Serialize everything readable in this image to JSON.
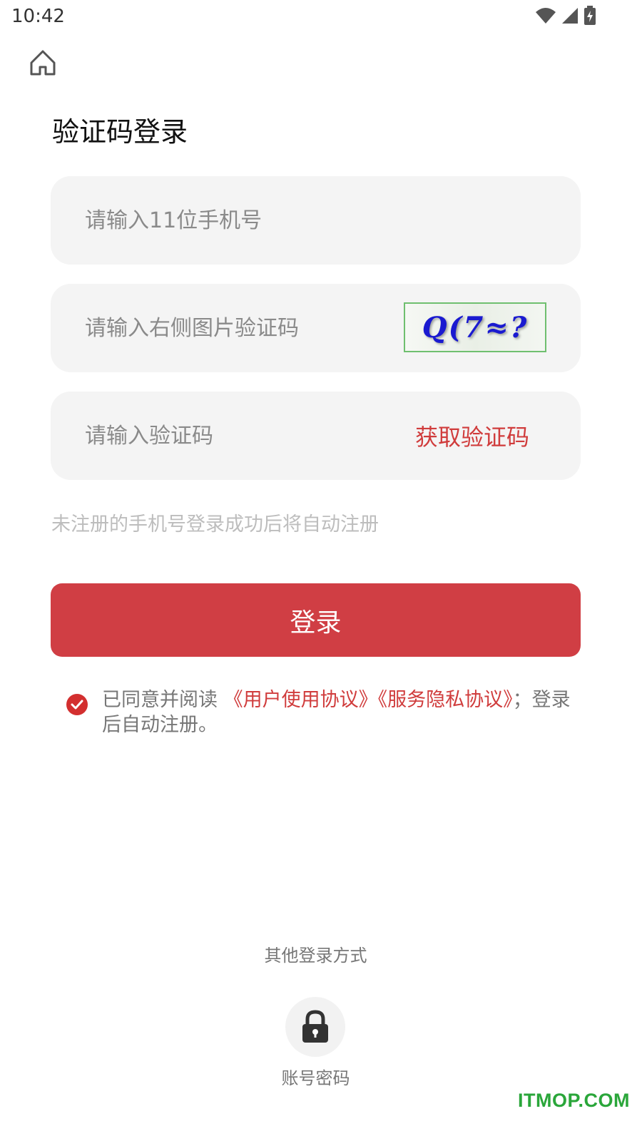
{
  "status_bar": {
    "time": "10:42",
    "icons": [
      "wifi-icon",
      "signal-icon",
      "battery-icon"
    ]
  },
  "header": {
    "home_icon": "home-icon",
    "title": "验证码登录"
  },
  "form": {
    "phone_placeholder": "请输入11位手机号",
    "captcha_placeholder": "请输入右侧图片验证码",
    "captcha_image_text": "Q(7≈?",
    "sms_placeholder": "请输入验证码",
    "get_code_label": "获取验证码",
    "hint": "未注册的手机号登录成功后将自动注册",
    "login_label": "登录"
  },
  "agreement": {
    "checked": true,
    "prefix": "已同意并阅读",
    "user_agreement": "《用户使用协议》",
    "privacy_agreement": "《服务隐私协议》",
    "suffix": "；登录后自动注册。"
  },
  "other_login": {
    "label": "其他登录方式",
    "method_icon": "lock-icon",
    "method_label": "账号密码"
  },
  "watermark": "ITMOP.COM",
  "colors": {
    "accent": "#d03e44",
    "field_bg": "#f4f4f4",
    "watermark": "#2aa63a"
  }
}
